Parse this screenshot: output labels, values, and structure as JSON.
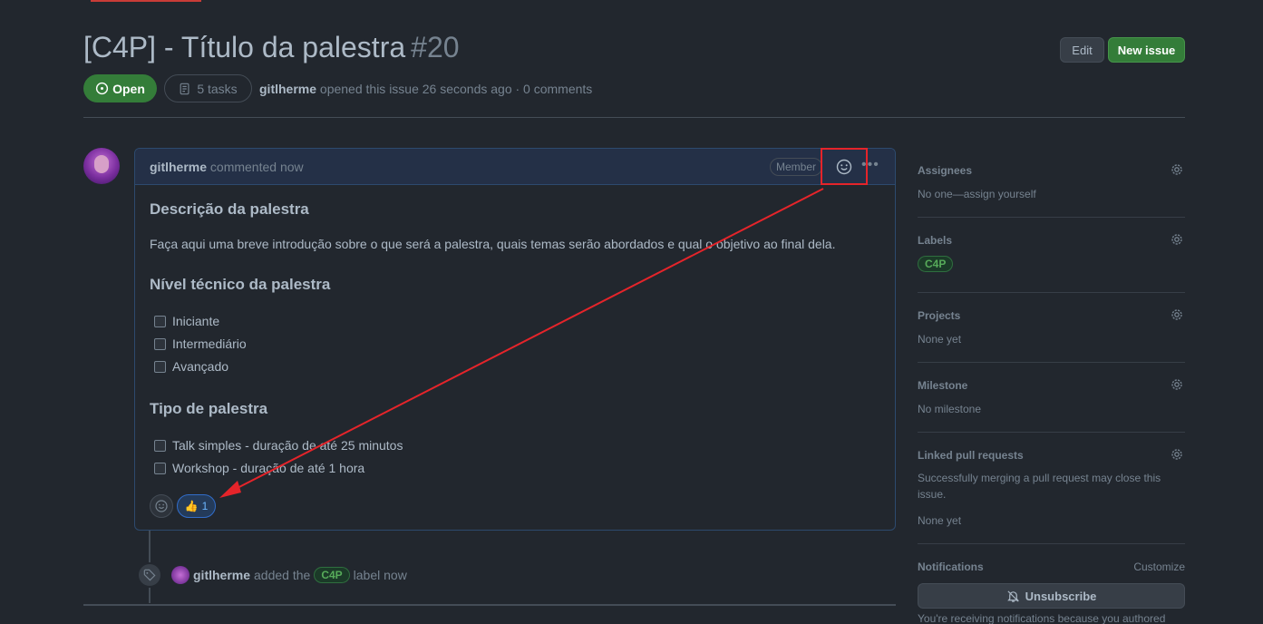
{
  "issue": {
    "title": "[C4P] - Título da palestra",
    "number": "#20",
    "state": "Open",
    "tasks": "5 tasks",
    "author": "gitlherme",
    "meta_text": "opened this issue 26 seconds ago · 0 comments"
  },
  "header_buttons": {
    "edit": "Edit",
    "new_issue": "New issue"
  },
  "comment": {
    "author": "gitlherme",
    "time_text": "commented now",
    "role_badge": "Member",
    "more_icon": "kebab-horizontal-icon",
    "heading1": "Descrição da palestra",
    "paragraph1": "Faça aqui uma breve introdução sobre o que será a palestra, quais temas serão abordados e qual o objetivo ao final dela.",
    "heading2": "Nível técnico da palestra",
    "levels": [
      "Iniciante",
      "Intermediário",
      "Avançado"
    ],
    "heading3": "Tipo de palestra",
    "types": [
      "Talk simples - duração de até 25 minutos",
      "Workshop - duração de até 1 hora"
    ],
    "reaction": {
      "emoji": "👍",
      "count": "1"
    }
  },
  "timeline_event": {
    "actor": "gitlherme",
    "text_before": "added the",
    "label": "C4P",
    "text_after": "label now"
  },
  "sidebar": {
    "assignees": {
      "title": "Assignees",
      "value": "No one—assign yourself"
    },
    "labels": {
      "title": "Labels",
      "label": "C4P"
    },
    "projects": {
      "title": "Projects",
      "value": "None yet"
    },
    "milestone": {
      "title": "Milestone",
      "value": "No milestone"
    },
    "linked_prs": {
      "title": "Linked pull requests",
      "desc": "Successfully merging a pull request may close this issue.",
      "value": "None yet"
    },
    "notifications": {
      "title": "Notifications",
      "customize": "Customize",
      "button": "Unsubscribe",
      "desc": "You're receiving notifications because you authored"
    }
  },
  "colors": {
    "background": "#22272e",
    "open_green": "#347d39",
    "annotation_red": "#e5242a",
    "label_green": "#57ab5a",
    "link_blue": "#6cb6ff"
  }
}
